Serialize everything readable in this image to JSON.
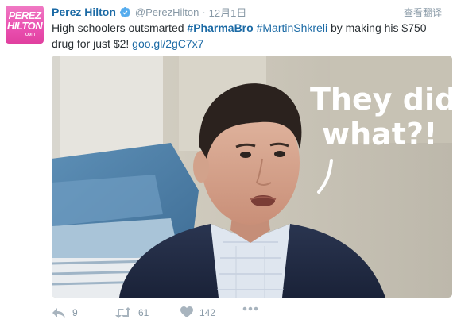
{
  "author": {
    "fullname": "Perez Hilton",
    "screen_name": "@PerezHilton",
    "separator": "·",
    "timestamp": "12月1日",
    "avatar_logo_lines": [
      "PEREZ",
      "HILTON",
      ".com"
    ],
    "verified_icon": "verified-badge-icon"
  },
  "translate_label": "查看翻译",
  "tweet": {
    "text_before": "High schoolers outsmarted ",
    "hashtag_1": "#PharmaBro",
    "space_1": " ",
    "hashtag_2": "#MartinShkreli",
    "text_after": " by making his $750 drug for just $2! ",
    "link": "goo.gl/2gC7x7"
  },
  "media": {
    "caption_overlay_line1": "They did",
    "caption_overlay_line2": "what?!"
  },
  "actions": {
    "reply": {
      "icon": "reply-icon",
      "count": "9"
    },
    "retweet": {
      "icon": "retweet-icon",
      "count": "61"
    },
    "like": {
      "icon": "heart-icon",
      "count": "142"
    },
    "more": {
      "icon": "more-dots-icon"
    }
  },
  "colors": {
    "link_blue": "#1b6aa5",
    "muted_gray": "#8899a6",
    "text_dark": "#292f33",
    "avatar_pink": "#ea4fb0"
  }
}
